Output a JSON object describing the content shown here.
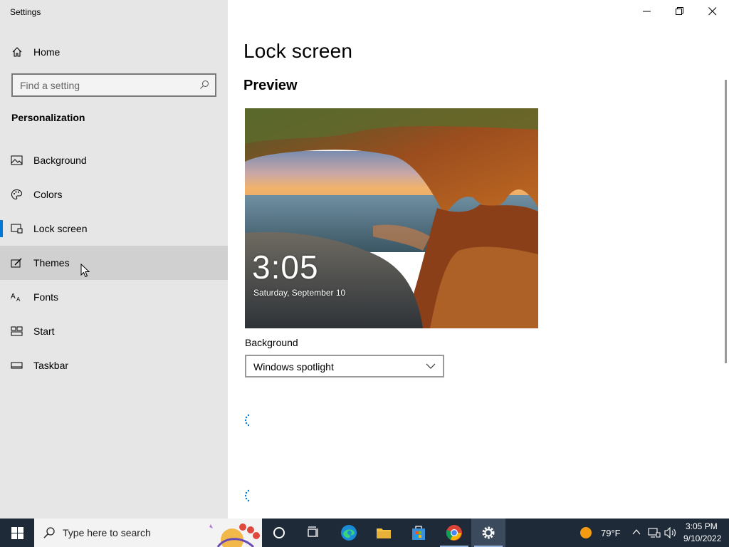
{
  "app": {
    "title": "Settings"
  },
  "sidebar": {
    "home_label": "Home",
    "search_placeholder": "Find a setting",
    "section_title": "Personalization",
    "items": [
      {
        "label": "Background",
        "icon": "picture-icon"
      },
      {
        "label": "Colors",
        "icon": "palette-icon"
      },
      {
        "label": "Lock screen",
        "icon": "lock-screen-icon",
        "selected": true
      },
      {
        "label": "Themes",
        "icon": "themes-icon",
        "hovered": true
      },
      {
        "label": "Fonts",
        "icon": "fonts-icon"
      },
      {
        "label": "Start",
        "icon": "start-icon"
      },
      {
        "label": "Taskbar",
        "icon": "taskbar-icon"
      }
    ]
  },
  "main": {
    "title": "Lock screen",
    "preview_title": "Preview",
    "preview": {
      "time": "3:05",
      "date": "Saturday, September 10"
    },
    "background_label": "Background",
    "background_value": "Windows spotlight"
  },
  "taskbar": {
    "search_placeholder": "Type here to search",
    "weather": "79°F",
    "time": "3:05 PM",
    "date": "9/10/2022"
  },
  "colors": {
    "accent": "#0078d7",
    "sidebar_bg": "#e6e6e6",
    "taskbar_bg": "#1f2a38"
  }
}
